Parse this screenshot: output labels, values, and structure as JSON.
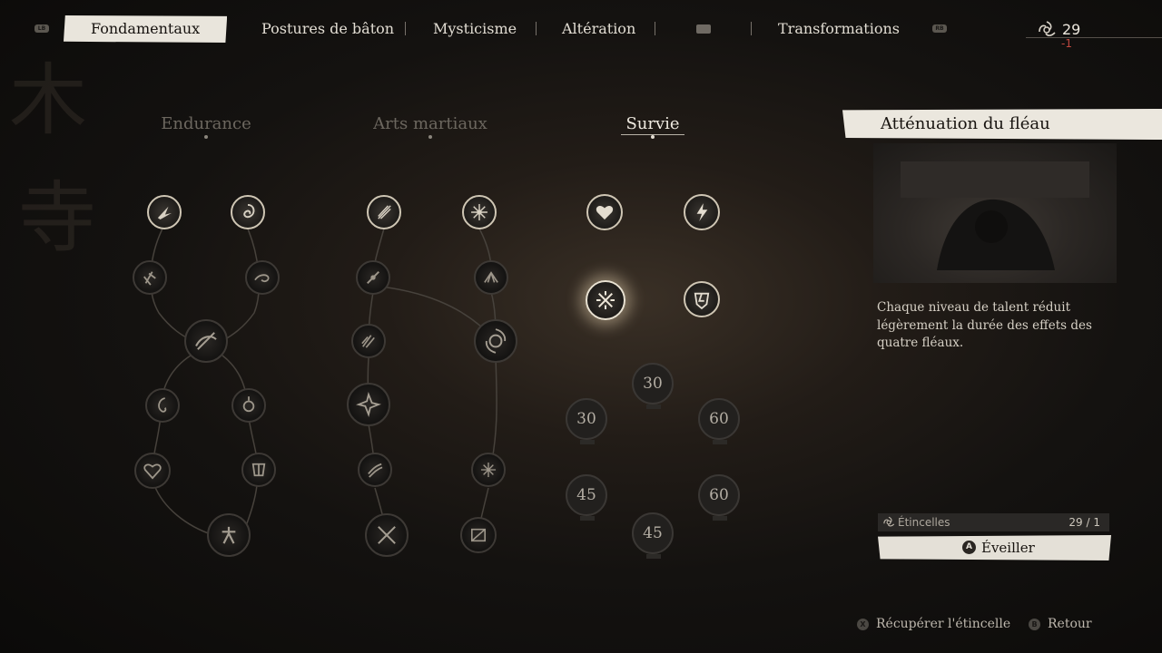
{
  "tabs": [
    {
      "label": "Fondamentaux",
      "active": true
    },
    {
      "label": "Postures de bâton"
    },
    {
      "label": "Mysticisme"
    },
    {
      "label": "Altération"
    },
    {
      "label": "Transformations"
    }
  ],
  "shoulder_buttons": {
    "left": "LB",
    "right": "RB"
  },
  "sparks": {
    "count": "29",
    "delta": "-1",
    "icon": "spark-icon"
  },
  "columns": [
    {
      "label": "Endurance"
    },
    {
      "label": "Arts martiaux"
    },
    {
      "label": "Survie",
      "active": true
    }
  ],
  "locked_nodes": [
    "30",
    "30",
    "60",
    "45",
    "60",
    "45"
  ],
  "detail": {
    "title": "Atténuation du fléau",
    "description": "Chaque niveau de talent réduit légèrement la durée des effets des quatre fléaux.",
    "sparks_label": "Étincelles",
    "sparks_value": "29 / 1",
    "awaken_button": "A",
    "awaken_label": "Éveiller"
  },
  "hints": [
    {
      "button": "X",
      "label": "Récupérer l'étincelle"
    },
    {
      "button": "B",
      "label": "Retour"
    }
  ],
  "colors": {
    "accent": "#e9e5dc",
    "delta": "#c0473f"
  }
}
